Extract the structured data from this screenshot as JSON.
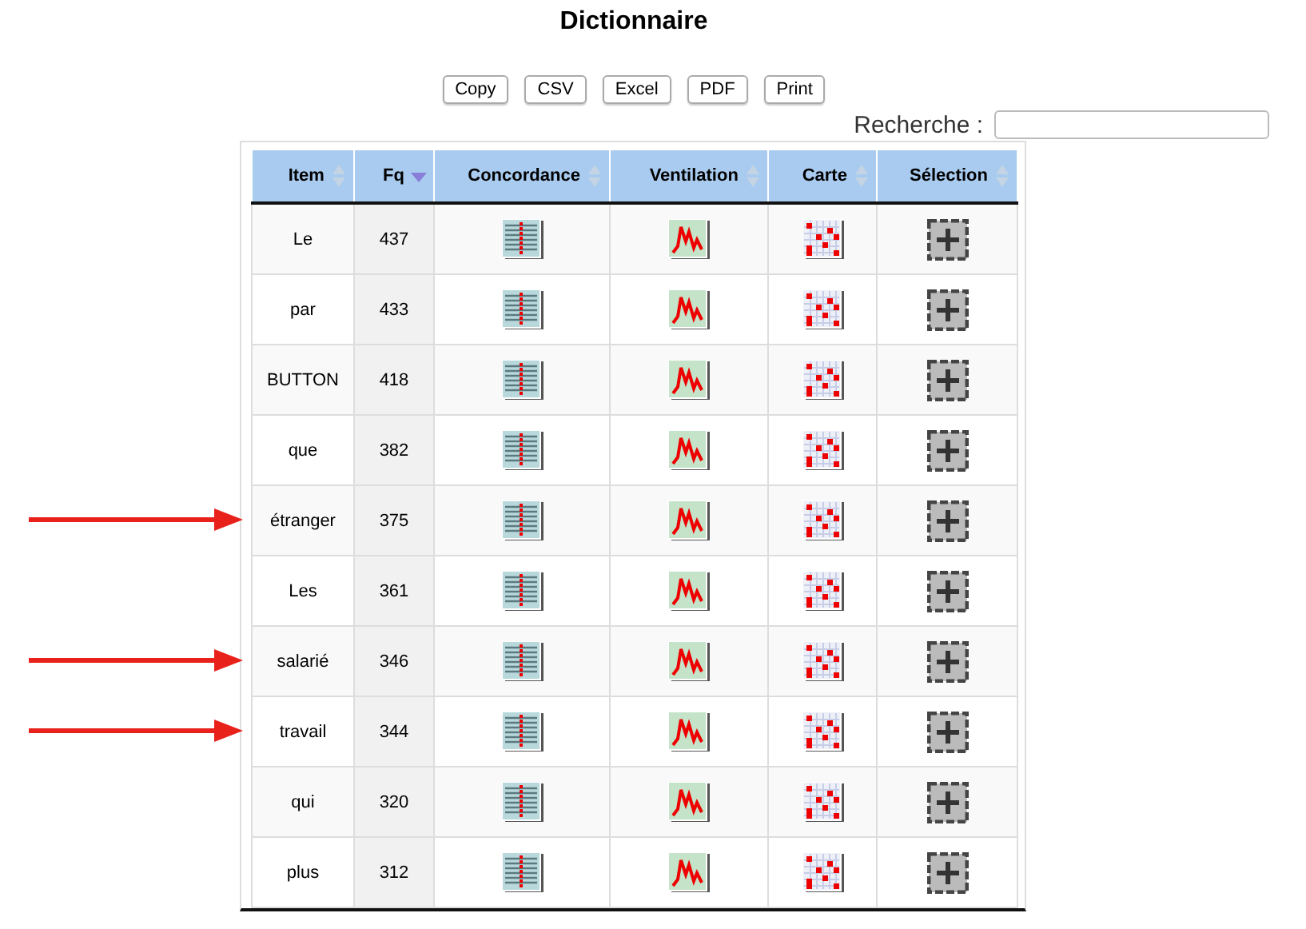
{
  "title": "Dictionnaire",
  "export_buttons": [
    "Copy",
    "CSV",
    "Excel",
    "PDF",
    "Print"
  ],
  "search": {
    "label": "Recherche :"
  },
  "table": {
    "columns": [
      {
        "label": "Item",
        "sorted": false
      },
      {
        "label": "Fq",
        "sorted": true
      },
      {
        "label": "Concordance",
        "sorted": false
      },
      {
        "label": "Ventilation",
        "sorted": false
      },
      {
        "label": "Carte",
        "sorted": false
      },
      {
        "label": "Sélection",
        "sorted": false
      }
    ],
    "rows": [
      {
        "item": "Le",
        "fq": "437",
        "arrow": false
      },
      {
        "item": "par",
        "fq": "433",
        "arrow": false
      },
      {
        "item": "BUTTON",
        "fq": "418",
        "arrow": false
      },
      {
        "item": "que",
        "fq": "382",
        "arrow": false
      },
      {
        "item": "étranger",
        "fq": "375",
        "arrow": true
      },
      {
        "item": "Les",
        "fq": "361",
        "arrow": false
      },
      {
        "item": "salarié",
        "fq": "346",
        "arrow": true
      },
      {
        "item": "travail",
        "fq": "344",
        "arrow": true
      },
      {
        "item": "qui",
        "fq": "320",
        "arrow": false
      },
      {
        "item": "plus",
        "fq": "312",
        "arrow": false
      }
    ]
  }
}
